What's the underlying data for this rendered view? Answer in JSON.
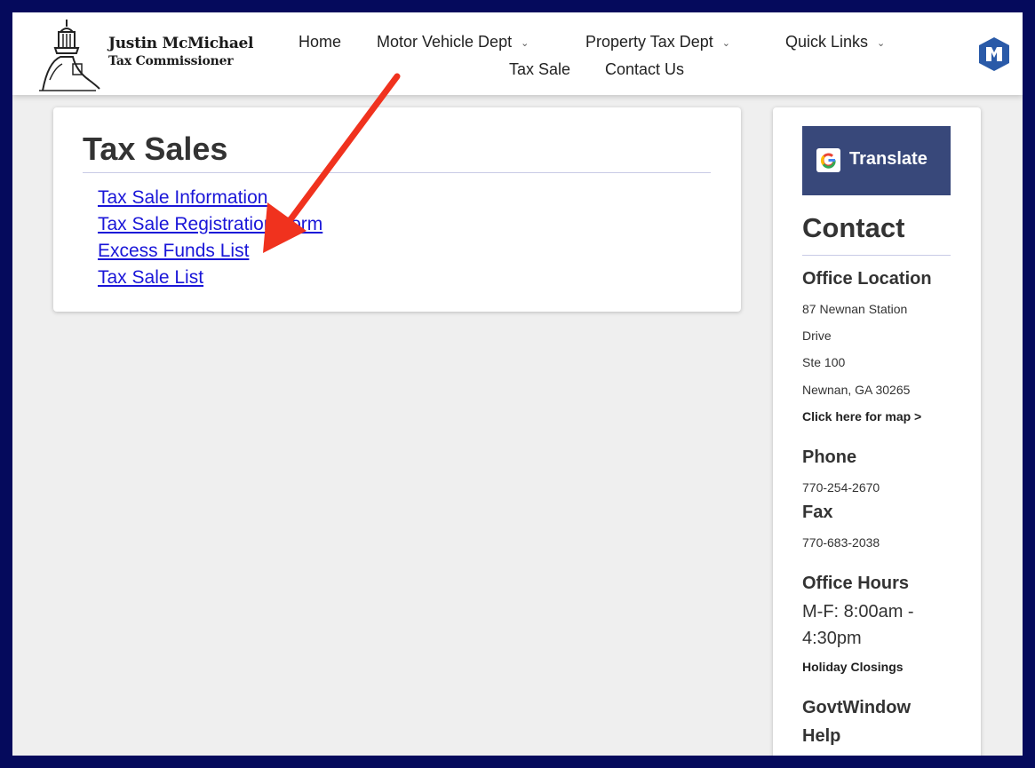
{
  "header": {
    "brand_name": "Justin McMichael",
    "brand_subtitle": "Tax Commissioner",
    "nav": [
      {
        "label": "Home"
      },
      {
        "label": "Motor Vehicle Dept"
      },
      {
        "label": "Property Tax Dept"
      },
      {
        "label": "Quick Links"
      },
      {
        "label": "Tax Sale"
      },
      {
        "label": "Contact Us"
      }
    ]
  },
  "main": {
    "title": "Tax Sales",
    "links": [
      {
        "label": "Tax Sale Information"
      },
      {
        "label": "Tax Sale Registration Form"
      },
      {
        "label": "Excess Funds List"
      },
      {
        "label": "Tax Sale List"
      }
    ]
  },
  "sidebar": {
    "translate_label": "Translate",
    "contact_heading": "Contact",
    "office_location_heading": "Office Location",
    "address_line1": "87 Newnan Station",
    "address_line2": "Drive",
    "address_line3": "Ste 100",
    "address_line4": "Newnan, GA 30265",
    "map_link": "Click here for map >",
    "phone_heading": "Phone",
    "phone": "770-254-2670",
    "fax_heading": "Fax",
    "fax": "770-683-2038",
    "hours_heading": "Office Hours",
    "hours_line1": "M-F: 8:00am -",
    "hours_line2": "4:30pm",
    "holiday_link": "Holiday Closings",
    "govtwindow_line1": "GovtWindow",
    "govtwindow_line2": "Help"
  },
  "colors": {
    "outer_border": "#050a5c",
    "link": "#1a16d8",
    "translate_button": "#38487a",
    "annotation_arrow": "#f0321e"
  },
  "icons": {
    "logo": "courthouse-dome-icon",
    "nav_dropdown": "chevron-down-icon",
    "google": "google-g-icon",
    "partner_logo": "govtwindow-logo-icon",
    "annotation": "red-arrow-annotation"
  }
}
